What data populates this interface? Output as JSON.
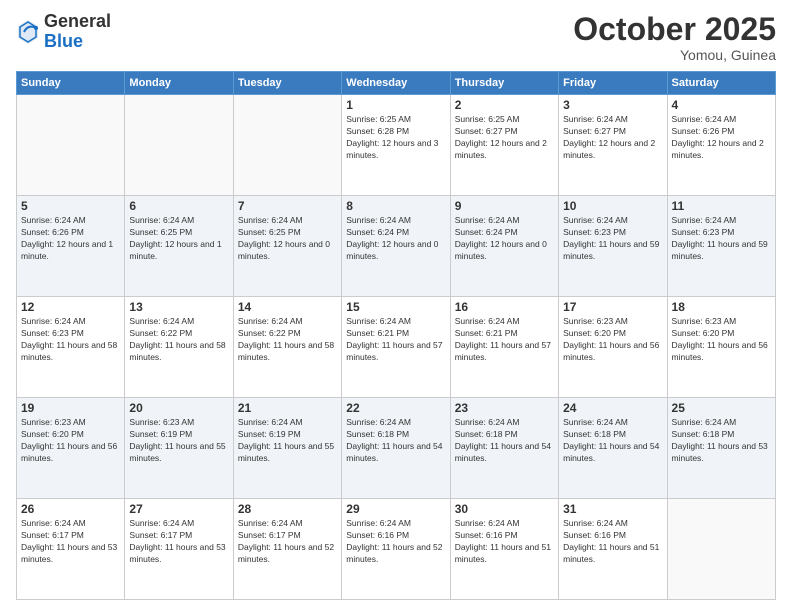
{
  "logo": {
    "general": "General",
    "blue": "Blue"
  },
  "title": "October 2025",
  "location": "Yomou, Guinea",
  "days_of_week": [
    "Sunday",
    "Monday",
    "Tuesday",
    "Wednesday",
    "Thursday",
    "Friday",
    "Saturday"
  ],
  "weeks": [
    {
      "alt": false,
      "days": [
        {
          "num": "",
          "info": ""
        },
        {
          "num": "",
          "info": ""
        },
        {
          "num": "",
          "info": ""
        },
        {
          "num": "1",
          "info": "Sunrise: 6:25 AM\nSunset: 6:28 PM\nDaylight: 12 hours and 3 minutes."
        },
        {
          "num": "2",
          "info": "Sunrise: 6:25 AM\nSunset: 6:27 PM\nDaylight: 12 hours and 2 minutes."
        },
        {
          "num": "3",
          "info": "Sunrise: 6:24 AM\nSunset: 6:27 PM\nDaylight: 12 hours and 2 minutes."
        },
        {
          "num": "4",
          "info": "Sunrise: 6:24 AM\nSunset: 6:26 PM\nDaylight: 12 hours and 2 minutes."
        }
      ]
    },
    {
      "alt": true,
      "days": [
        {
          "num": "5",
          "info": "Sunrise: 6:24 AM\nSunset: 6:26 PM\nDaylight: 12 hours and 1 minute."
        },
        {
          "num": "6",
          "info": "Sunrise: 6:24 AM\nSunset: 6:25 PM\nDaylight: 12 hours and 1 minute."
        },
        {
          "num": "7",
          "info": "Sunrise: 6:24 AM\nSunset: 6:25 PM\nDaylight: 12 hours and 0 minutes."
        },
        {
          "num": "8",
          "info": "Sunrise: 6:24 AM\nSunset: 6:24 PM\nDaylight: 12 hours and 0 minutes."
        },
        {
          "num": "9",
          "info": "Sunrise: 6:24 AM\nSunset: 6:24 PM\nDaylight: 12 hours and 0 minutes."
        },
        {
          "num": "10",
          "info": "Sunrise: 6:24 AM\nSunset: 6:23 PM\nDaylight: 11 hours and 59 minutes."
        },
        {
          "num": "11",
          "info": "Sunrise: 6:24 AM\nSunset: 6:23 PM\nDaylight: 11 hours and 59 minutes."
        }
      ]
    },
    {
      "alt": false,
      "days": [
        {
          "num": "12",
          "info": "Sunrise: 6:24 AM\nSunset: 6:23 PM\nDaylight: 11 hours and 58 minutes."
        },
        {
          "num": "13",
          "info": "Sunrise: 6:24 AM\nSunset: 6:22 PM\nDaylight: 11 hours and 58 minutes."
        },
        {
          "num": "14",
          "info": "Sunrise: 6:24 AM\nSunset: 6:22 PM\nDaylight: 11 hours and 58 minutes."
        },
        {
          "num": "15",
          "info": "Sunrise: 6:24 AM\nSunset: 6:21 PM\nDaylight: 11 hours and 57 minutes."
        },
        {
          "num": "16",
          "info": "Sunrise: 6:24 AM\nSunset: 6:21 PM\nDaylight: 11 hours and 57 minutes."
        },
        {
          "num": "17",
          "info": "Sunrise: 6:23 AM\nSunset: 6:20 PM\nDaylight: 11 hours and 56 minutes."
        },
        {
          "num": "18",
          "info": "Sunrise: 6:23 AM\nSunset: 6:20 PM\nDaylight: 11 hours and 56 minutes."
        }
      ]
    },
    {
      "alt": true,
      "days": [
        {
          "num": "19",
          "info": "Sunrise: 6:23 AM\nSunset: 6:20 PM\nDaylight: 11 hours and 56 minutes."
        },
        {
          "num": "20",
          "info": "Sunrise: 6:23 AM\nSunset: 6:19 PM\nDaylight: 11 hours and 55 minutes."
        },
        {
          "num": "21",
          "info": "Sunrise: 6:24 AM\nSunset: 6:19 PM\nDaylight: 11 hours and 55 minutes."
        },
        {
          "num": "22",
          "info": "Sunrise: 6:24 AM\nSunset: 6:18 PM\nDaylight: 11 hours and 54 minutes."
        },
        {
          "num": "23",
          "info": "Sunrise: 6:24 AM\nSunset: 6:18 PM\nDaylight: 11 hours and 54 minutes."
        },
        {
          "num": "24",
          "info": "Sunrise: 6:24 AM\nSunset: 6:18 PM\nDaylight: 11 hours and 54 minutes."
        },
        {
          "num": "25",
          "info": "Sunrise: 6:24 AM\nSunset: 6:18 PM\nDaylight: 11 hours and 53 minutes."
        }
      ]
    },
    {
      "alt": false,
      "days": [
        {
          "num": "26",
          "info": "Sunrise: 6:24 AM\nSunset: 6:17 PM\nDaylight: 11 hours and 53 minutes."
        },
        {
          "num": "27",
          "info": "Sunrise: 6:24 AM\nSunset: 6:17 PM\nDaylight: 11 hours and 53 minutes."
        },
        {
          "num": "28",
          "info": "Sunrise: 6:24 AM\nSunset: 6:17 PM\nDaylight: 11 hours and 52 minutes."
        },
        {
          "num": "29",
          "info": "Sunrise: 6:24 AM\nSunset: 6:16 PM\nDaylight: 11 hours and 52 minutes."
        },
        {
          "num": "30",
          "info": "Sunrise: 6:24 AM\nSunset: 6:16 PM\nDaylight: 11 hours and 51 minutes."
        },
        {
          "num": "31",
          "info": "Sunrise: 6:24 AM\nSunset: 6:16 PM\nDaylight: 11 hours and 51 minutes."
        },
        {
          "num": "",
          "info": ""
        }
      ]
    }
  ]
}
